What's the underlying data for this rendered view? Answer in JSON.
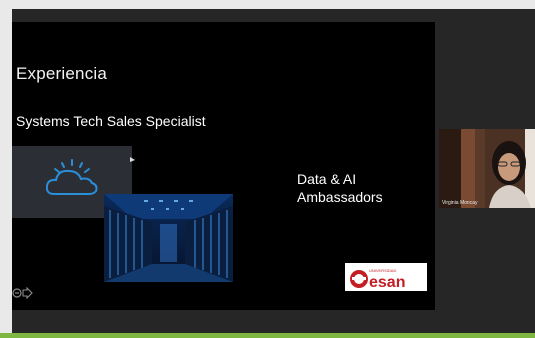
{
  "slide": {
    "title": "Experiencia",
    "subtitle": "Systems Tech Sales Specialist",
    "ambassadors": [
      "Data & AI",
      "Ambassadors"
    ],
    "logo_text_small": "UNIVERSIDAD",
    "logo_text_big": "esan"
  },
  "participant": {
    "name": "Virginia Moncay"
  },
  "colors": {
    "bottom_bar": "#7db640",
    "cloud_icon": "#2a8fd8",
    "esan_red": "#c41e25"
  },
  "icons": {
    "cloud": "cloud-icon",
    "slide_nav": "slide-nav-icon"
  }
}
